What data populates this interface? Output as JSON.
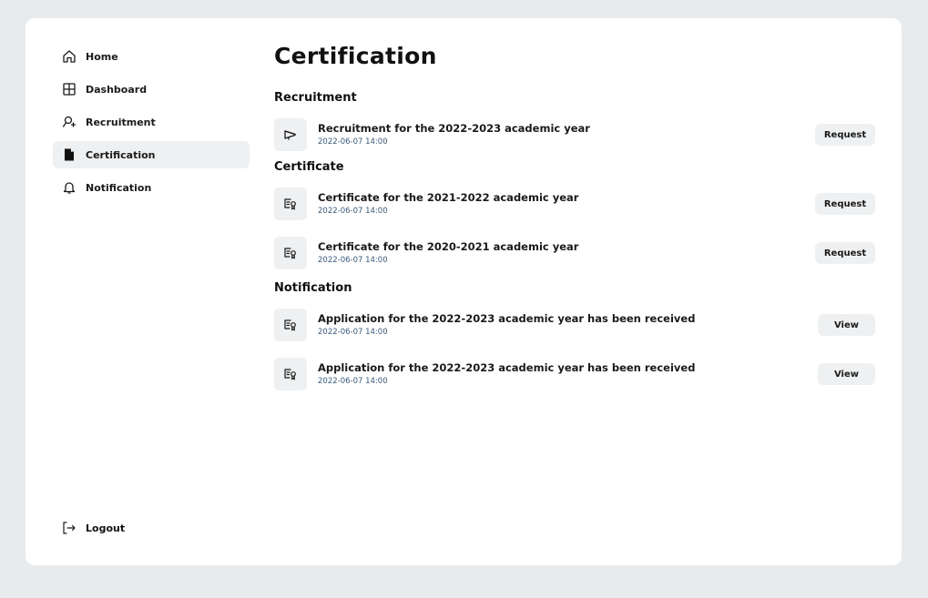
{
  "sidebar": {
    "items": [
      {
        "label": "Home",
        "icon": "home-icon"
      },
      {
        "label": "Dashboard",
        "icon": "dashboard-icon"
      },
      {
        "label": "Recruitment",
        "icon": "recruitment-icon"
      },
      {
        "label": "Certification",
        "icon": "document-icon",
        "active": true
      },
      {
        "label": "Notification",
        "icon": "bell-icon"
      }
    ],
    "logout_label": "Logout"
  },
  "main": {
    "title": "Certification",
    "recruitment": {
      "heading": "Recruitment",
      "items": [
        {
          "title": "Recruitment for the 2022-2023 academic year",
          "date": "2022-06-07 14:00",
          "button": "Request",
          "icon": "megaphone-icon"
        }
      ]
    },
    "certificate": {
      "heading": "Certificate",
      "items": [
        {
          "title": "Certificate for the 2021-2022 academic year",
          "date": "2022-06-07 14:00",
          "button": "Request",
          "icon": "certificate-icon"
        },
        {
          "title": "Certificate for the 2020-2021 academic year",
          "date": "2022-06-07 14:00",
          "button": "Request",
          "icon": "certificate-icon"
        }
      ]
    },
    "notification": {
      "heading": "Notification",
      "items": [
        {
          "title": "Application for the 2022-2023 academic year has been received",
          "date": "2022-06-07 14:00",
          "button": "View",
          "icon": "certificate-icon"
        },
        {
          "title": "Application for the 2022-2023 academic year has been received",
          "date": "2022-06-07 14:00",
          "button": "View",
          "icon": "certificate-icon"
        }
      ]
    }
  }
}
